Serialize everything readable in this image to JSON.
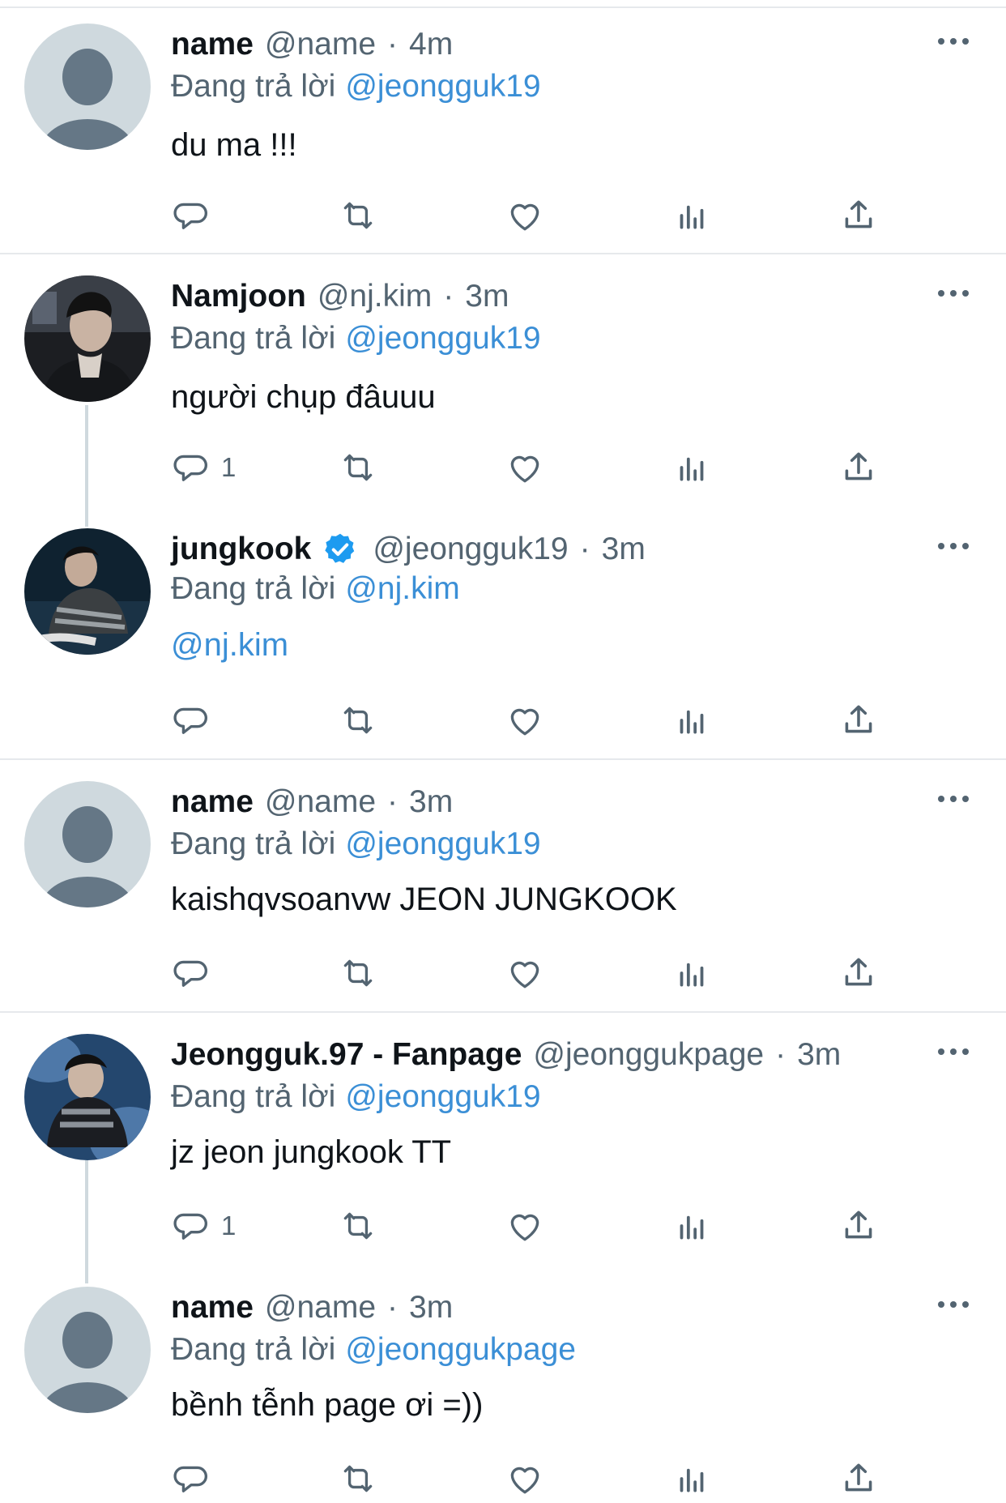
{
  "tweets": [
    {
      "name": "name",
      "handle": "@name",
      "time": "4m",
      "reply_prefix": "Đang trả lời",
      "reply_to": "@jeongguk19",
      "text": "du ma !!!",
      "reply_count": "",
      "avatar": "default-avatar"
    },
    {
      "name": "Namjoon",
      "handle": "@nj.kim",
      "time": "3m",
      "reply_prefix": "Đang trả lời",
      "reply_to": "@jeongguk19",
      "text": "người chụp đâuuu",
      "reply_count": "1",
      "avatar": "photo-avatar"
    },
    {
      "name": "jungkook",
      "handle": "@jeongguk19",
      "time": "3m",
      "verified": true,
      "reply_prefix": "Đang trả lời",
      "reply_to": "@nj.kim",
      "text": "@nj.kim",
      "reply_count": "",
      "avatar": "photo-avatar"
    },
    {
      "name": "name",
      "handle": "@name",
      "time": "3m",
      "reply_prefix": "Đang trả lời",
      "reply_to": "@jeongguk19",
      "text": "kaishqvsoanvw JEON JUNGKOOK",
      "reply_count": "",
      "avatar": "default-avatar"
    },
    {
      "name": "Jeongguk.97 - Fanpage",
      "handle": "@jeonggukpage",
      "time": "3m",
      "reply_prefix": "Đang trả lời",
      "reply_to": "@jeongguk19",
      "text": "jz jeon jungkook TT",
      "reply_count": "1",
      "avatar": "photo-avatar"
    },
    {
      "name": "name",
      "handle": "@name",
      "time": "3m",
      "reply_prefix": "Đang trả lời",
      "reply_to": "@jeonggukpage",
      "text": "bềnh tễnh page ơi =))",
      "reply_count": "",
      "avatar": "default-avatar"
    }
  ],
  "separator": "·",
  "icons": {
    "reply": "reply-icon",
    "retweet": "retweet-icon",
    "like": "heart-icon",
    "views": "views-icon",
    "share": "share-icon",
    "more": "more-icon",
    "verified": "verified-badge-icon"
  },
  "colors": {
    "mention": "#3b8fd6",
    "muted": "#536471",
    "verified": "#1d9bf0",
    "divider": "#e6e9ec"
  }
}
